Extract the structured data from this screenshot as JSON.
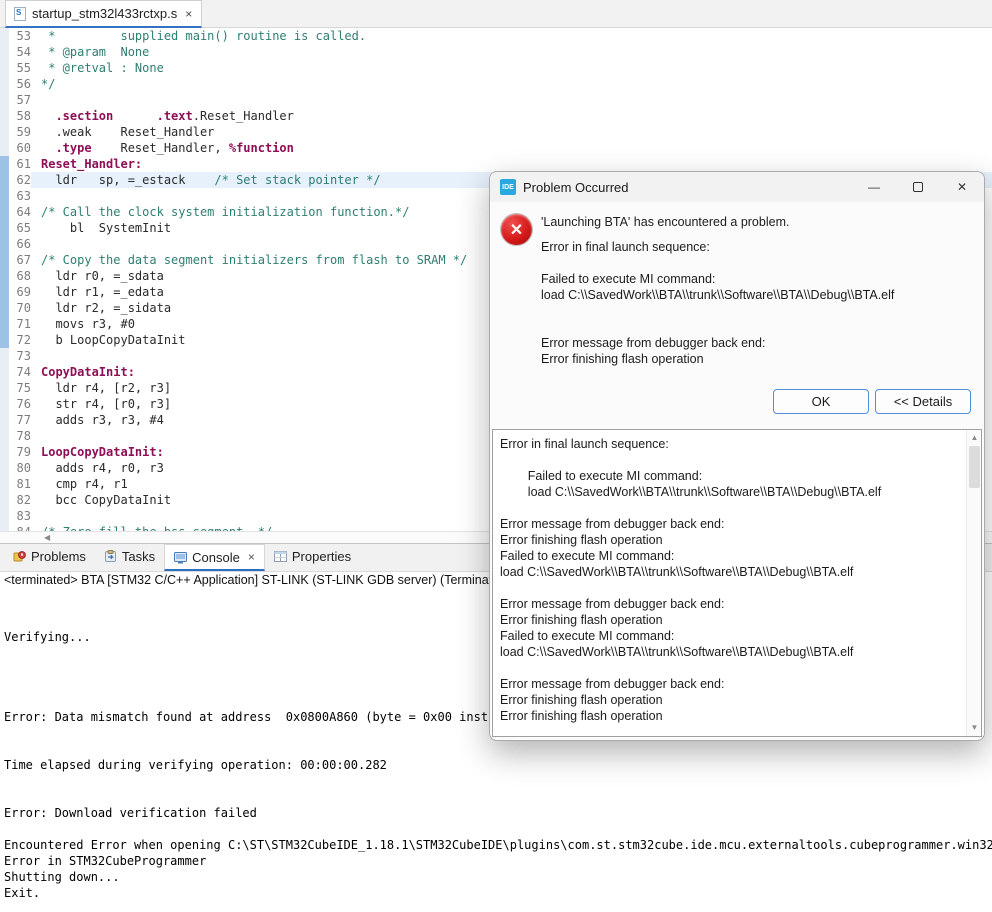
{
  "editor": {
    "tab": {
      "filename": "startup_stm32l433rctxp.s",
      "close_glyph": "×",
      "file_icon_letter": "S"
    },
    "hscroll_left_glyph": "◀",
    "lines": [
      {
        "n": 53,
        "s": [
          [
            "c",
            " *         supplied main() routine is called."
          ]
        ]
      },
      {
        "n": 54,
        "s": [
          [
            "c",
            " * @param  None"
          ]
        ]
      },
      {
        "n": 55,
        "s": [
          [
            "c",
            " * @retval : None"
          ]
        ]
      },
      {
        "n": 56,
        "s": [
          [
            "c",
            "*/"
          ]
        ]
      },
      {
        "n": 57,
        "s": []
      },
      {
        "n": 58,
        "s": [
          [
            "p",
            "  "
          ],
          [
            "k",
            ".section"
          ],
          [
            "p",
            "      "
          ],
          [
            "k",
            ".text"
          ],
          [
            "p",
            ".Reset_Handler"
          ]
        ]
      },
      {
        "n": 59,
        "s": [
          [
            "p",
            "  .weak    Reset_Handler"
          ]
        ]
      },
      {
        "n": 60,
        "s": [
          [
            "p",
            "  "
          ],
          [
            "k",
            ".type"
          ],
          [
            "p",
            "    Reset_Handler, "
          ],
          [
            "k",
            "%function"
          ]
        ]
      },
      {
        "n": 61,
        "r": true,
        "s": [
          [
            "l",
            "Reset_Handler:"
          ]
        ]
      },
      {
        "n": 62,
        "r": true,
        "hl": true,
        "s": [
          [
            "p",
            "  ldr   sp, =_estack    "
          ],
          [
            "c",
            "/* Set stack pointer */"
          ]
        ]
      },
      {
        "n": 63,
        "r": true,
        "s": []
      },
      {
        "n": 64,
        "r": true,
        "s": [
          [
            "c",
            "/* Call the clock system initialization function.*/"
          ]
        ]
      },
      {
        "n": 65,
        "r": true,
        "s": [
          [
            "p",
            "    bl  SystemInit"
          ]
        ]
      },
      {
        "n": 66,
        "r": true,
        "s": []
      },
      {
        "n": 67,
        "r": true,
        "s": [
          [
            "c",
            "/* Copy the data segment initializers from flash to SRAM */"
          ]
        ]
      },
      {
        "n": 68,
        "r": true,
        "s": [
          [
            "p",
            "  ldr r0, =_sdata"
          ]
        ]
      },
      {
        "n": 69,
        "r": true,
        "s": [
          [
            "p",
            "  ldr r1, =_edata"
          ]
        ]
      },
      {
        "n": 70,
        "r": true,
        "s": [
          [
            "p",
            "  ldr r2, =_sidata"
          ]
        ]
      },
      {
        "n": 71,
        "r": true,
        "s": [
          [
            "p",
            "  movs r3, #0"
          ]
        ]
      },
      {
        "n": 72,
        "r": true,
        "s": [
          [
            "p",
            "  b LoopCopyDataInit"
          ]
        ]
      },
      {
        "n": 73,
        "s": []
      },
      {
        "n": 74,
        "s": [
          [
            "l",
            "CopyDataInit:"
          ]
        ]
      },
      {
        "n": 75,
        "s": [
          [
            "p",
            "  ldr r4, [r2, r3]"
          ]
        ]
      },
      {
        "n": 76,
        "s": [
          [
            "p",
            "  str r4, [r0, r3]"
          ]
        ]
      },
      {
        "n": 77,
        "s": [
          [
            "p",
            "  adds r3, r3, #4"
          ]
        ]
      },
      {
        "n": 78,
        "s": []
      },
      {
        "n": 79,
        "s": [
          [
            "l",
            "LoopCopyDataInit:"
          ]
        ]
      },
      {
        "n": 80,
        "s": [
          [
            "p",
            "  adds r4, r0, r3"
          ]
        ]
      },
      {
        "n": 81,
        "s": [
          [
            "p",
            "  cmp r4, r1"
          ]
        ]
      },
      {
        "n": 82,
        "s": [
          [
            "p",
            "  bcc CopyDataInit"
          ]
        ]
      },
      {
        "n": 83,
        "s": []
      },
      {
        "n": 84,
        "s": [
          [
            "c",
            "/* Zero fill the bss segment. */"
          ]
        ]
      }
    ]
  },
  "console_panel": {
    "tabs": [
      {
        "label": "Problems"
      },
      {
        "label": "Tasks"
      },
      {
        "label": "Console",
        "active": true,
        "close_glyph": "×"
      },
      {
        "label": "Properties"
      }
    ],
    "status_line": "<terminated> BTA [STM32 C/C++ Application] ST-LINK (ST-LINK GDB server) (Terminated J",
    "output_lines": [
      "",
      "",
      "Verifying...",
      "",
      "",
      "",
      "",
      "Error: Data mismatch found at address  0x0800A860 (byte = 0x00 inst",
      "",
      "",
      "Time elapsed during verifying operation: 00:00:00.282",
      "",
      "",
      "Error: Download verification failed",
      "",
      "Encountered Error when opening C:\\ST\\STM32CubeIDE_1.18.1\\STM32CubeIDE\\plugins\\com.st.stm32cube.ide.mcu.externaltools.cubeprogrammer.win32",
      "Error in STM32CubeProgrammer",
      "Shutting down...",
      "Exit."
    ]
  },
  "dialog": {
    "title": "Problem Occurred",
    "app_icon_label": "IDE",
    "window_controls": {
      "minimize_glyph": "—",
      "close_glyph": "✕"
    },
    "error_icon_glyph": "✕",
    "summary": "'Launching BTA' has encountered a problem.",
    "message_lines": [
      "Error in final launch sequence:",
      "",
      "Failed to execute MI command:",
      "load C:\\\\SavedWork\\\\BTA\\\\trunk\\\\Software\\\\BTA\\\\Debug\\\\BTA.elf",
      "",
      "",
      "Error message from debugger back end:",
      "Error finishing flash operation"
    ],
    "buttons": {
      "ok": "OK",
      "details": "<< Details"
    },
    "details_lines": [
      "Error in final launch sequence:",
      "",
      "\tFailed to execute MI command:",
      "\tload C:\\\\SavedWork\\\\BTA\\\\trunk\\\\Software\\\\BTA\\\\Debug\\\\BTA.elf",
      "",
      "Error message from debugger back end:",
      "Error finishing flash operation",
      "Failed to execute MI command:",
      "load C:\\\\SavedWork\\\\BTA\\\\trunk\\\\Software\\\\BTA\\\\Debug\\\\BTA.elf",
      "",
      "Error message from debugger back end:",
      "Error finishing flash operation",
      "Failed to execute MI command:",
      "load C:\\\\SavedWork\\\\BTA\\\\trunk\\\\Software\\\\BTA\\\\Debug\\\\BTA.elf",
      "",
      "Error message from debugger back end:",
      "Error finishing flash operation",
      "Error finishing flash operation"
    ],
    "scrollbar": {
      "up_glyph": "▲",
      "down_glyph": "▼"
    }
  },
  "colors": {
    "accent_blue": "#3472c4",
    "keyword": "#8e0f56",
    "comment": "#2e7e72",
    "error_red": "#d61a1a",
    "button_border_blue": "#4f8fd8"
  }
}
